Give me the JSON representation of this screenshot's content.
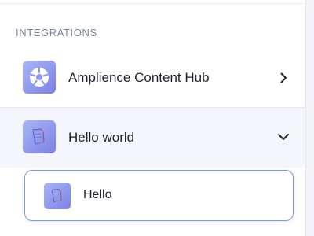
{
  "sidebar": {
    "section_title": "INTEGRATIONS",
    "items": [
      {
        "label": "Amplience Content Hub",
        "icon": "amplience-logo-icon",
        "state": "collapsed",
        "chevron": "chevron-right-icon"
      },
      {
        "label": "Hello world",
        "icon": "document-icon",
        "state": "expanded",
        "chevron": "chevron-down-icon",
        "children": [
          {
            "label": "Hello",
            "icon": "document-icon",
            "selected": true
          }
        ]
      }
    ]
  },
  "colors": {
    "icon_gradient_start": "#a7b6f5",
    "icon_gradient_end": "#7b80e6",
    "selected_border": "#7f9bd8",
    "text": "#1f2433",
    "section_title": "#7a8496"
  }
}
